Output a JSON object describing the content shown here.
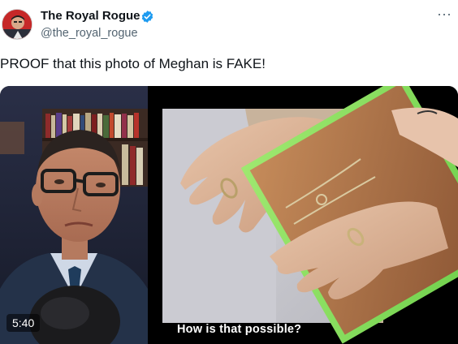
{
  "author": {
    "display_name": "The Royal Rogue",
    "handle": "@the_royal_rogue",
    "verified_color": "#1d9bf0"
  },
  "menu": {
    "more_label": "···"
  },
  "tweet": {
    "text": "PROOF that this photo of Meghan is FAKE!"
  },
  "media": {
    "duration": "5:40",
    "caption": "How is that possible?"
  },
  "colors": {
    "text": "#0f1419",
    "secondary": "#536471",
    "accent": "#1d9bf0",
    "green_overlay": "#7ed957"
  }
}
